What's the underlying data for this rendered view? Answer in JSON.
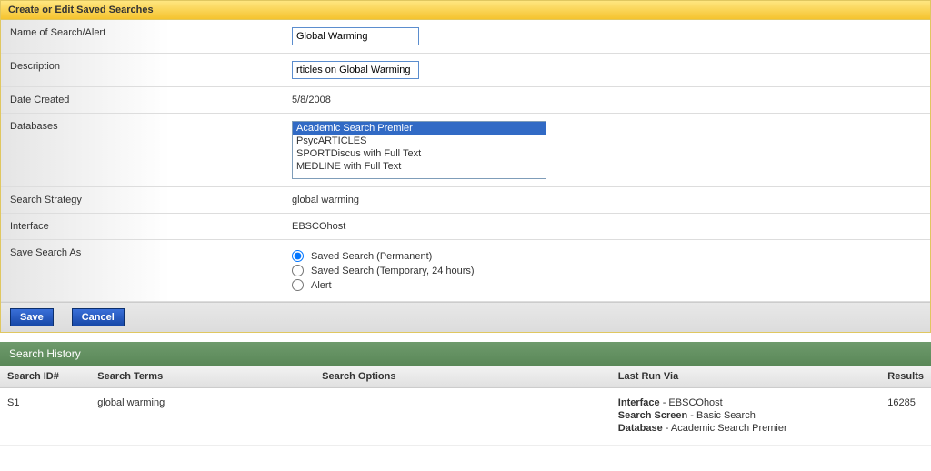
{
  "panel": {
    "title": "Create or Edit Saved Searches"
  },
  "form": {
    "name": {
      "label": "Name of Search/Alert",
      "value": "Global Warming"
    },
    "description": {
      "label": "Description",
      "value": "rticles on Global Warming"
    },
    "date_created": {
      "label": "Date Created",
      "value": "5/8/2008"
    },
    "databases": {
      "label": "Databases",
      "items": [
        {
          "name": "Academic Search Premier",
          "selected": true
        },
        {
          "name": "PsycARTICLES",
          "selected": false
        },
        {
          "name": "SPORTDiscus with Full Text",
          "selected": false
        },
        {
          "name": "MEDLINE with Full Text",
          "selected": false
        }
      ]
    },
    "search_strategy": {
      "label": "Search Strategy",
      "value": "global warming"
    },
    "interface": {
      "label": "Interface",
      "value": "EBSCOhost"
    },
    "save_as": {
      "label": "Save Search As",
      "options": [
        {
          "label": "Saved Search (Permanent)",
          "checked": true
        },
        {
          "label": "Saved Search (Temporary, 24 hours)",
          "checked": false
        },
        {
          "label": "Alert",
          "checked": false
        }
      ]
    }
  },
  "buttons": {
    "save": "Save",
    "cancel": "Cancel"
  },
  "history": {
    "title": "Search History",
    "columns": {
      "id": "Search ID#",
      "terms": "Search Terms",
      "options": "Search Options",
      "last_run": "Last Run Via",
      "results": "Results"
    },
    "rows": [
      {
        "id": "S1",
        "terms": "global warming",
        "options": "",
        "last_run": {
          "interface_label": "Interface",
          "interface_value": "EBSCOhost",
          "screen_label": "Search Screen",
          "screen_value": "Basic Search",
          "database_label": "Database",
          "database_value": "Academic Search Premier"
        },
        "results": "16285"
      }
    ]
  }
}
